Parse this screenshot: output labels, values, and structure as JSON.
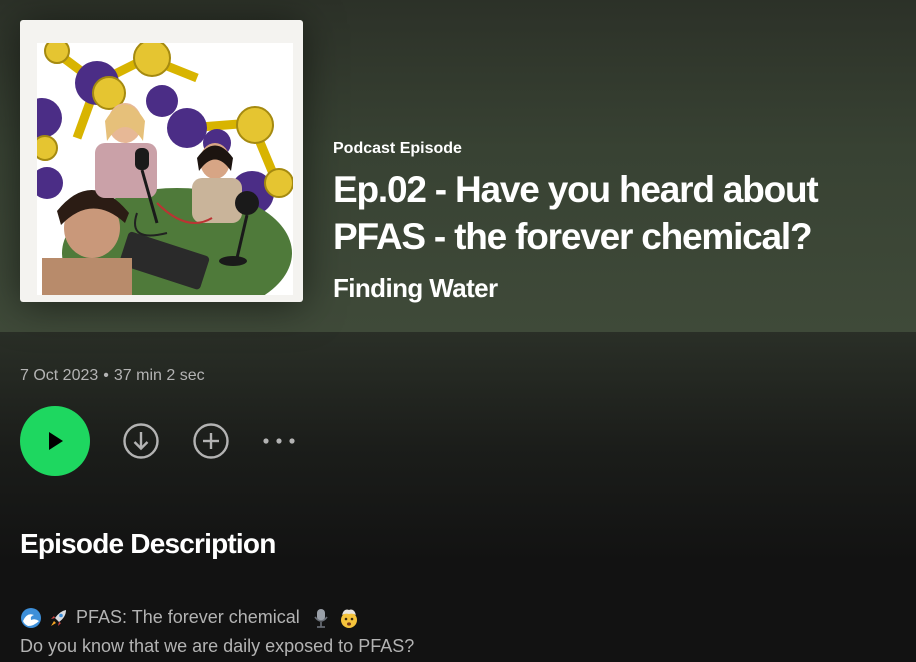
{
  "hero": {
    "type_label": "Podcast Episode",
    "title": "Ep.02 - Have you heard about PFAS - the forever chemical?",
    "show_name": "Finding Water"
  },
  "info": {
    "date": "7 Oct 2023",
    "separator": "•",
    "duration": "37 min 2 sec"
  },
  "actions": {
    "play": "play-icon",
    "download": "download-icon",
    "add": "add-icon",
    "more": "more-icon"
  },
  "description": {
    "heading": "Episode Description",
    "line1_text": "PFAS: The forever chemical",
    "line1_prefix_icons": [
      "wave-emoji-icon",
      "rocket-emoji-icon"
    ],
    "line1_suffix_icons": [
      "microphone-emoji-icon",
      "exploding-head-emoji-icon"
    ],
    "line2_text": "Do you know that we are daily exposed to PFAS?"
  },
  "colors": {
    "accent": "#1ed760",
    "hero_bg": "#3f4a39",
    "page_bg": "#121212",
    "muted_text": "#b3b3b3"
  }
}
